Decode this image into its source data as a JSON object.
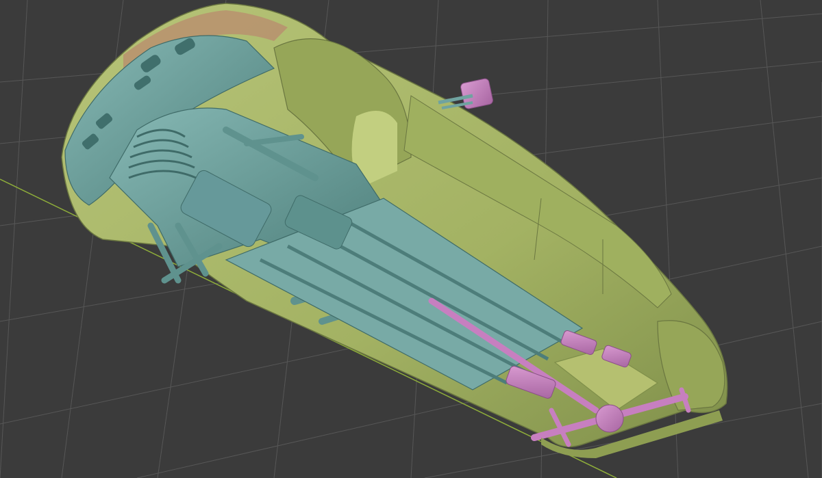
{
  "viewport": {
    "background_color": "#3b3b3b",
    "grid_color": "#5a5a5a",
    "x_axis_color": "#8fae3a"
  },
  "model": {
    "body_color": "#a9b86a",
    "body_shadow_color": "#7f8f4a",
    "chassis_color": "#6fa3a0",
    "chassis_dark_color": "#4d7d7a",
    "drivetrain_color": "#c77fc0",
    "trim_color": "#b89070"
  }
}
